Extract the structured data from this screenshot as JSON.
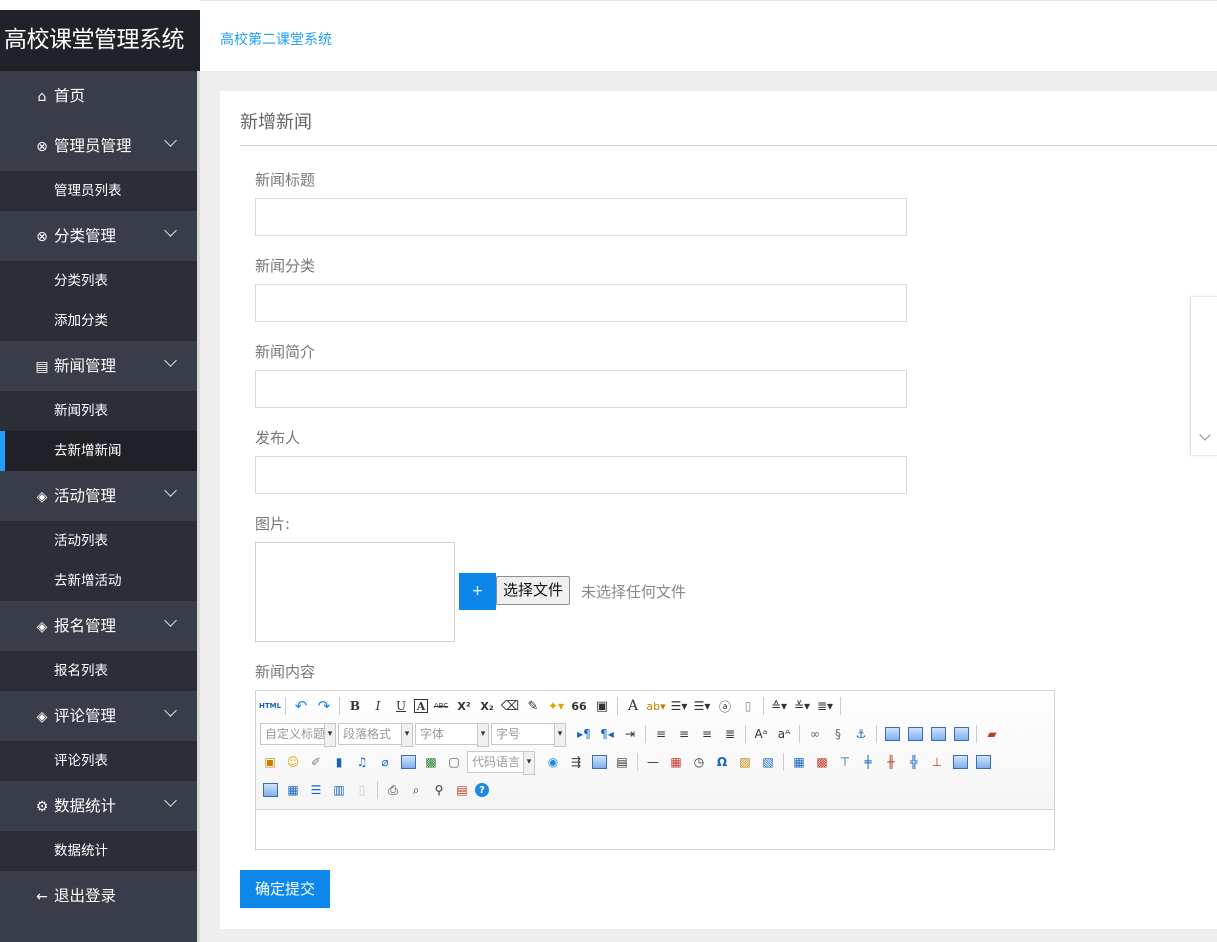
{
  "sidebar": {
    "logo": "高校课堂管理系统",
    "items": [
      {
        "icon": "home-icon",
        "glyph": "⌂",
        "label": "首页"
      },
      {
        "icon": "user-circle-icon",
        "glyph": "⊗",
        "label": "管理员管理",
        "sub": [
          "管理员列表"
        ]
      },
      {
        "icon": "user-circle-icon",
        "glyph": "⊗",
        "label": "分类管理",
        "sub": [
          "分类列表",
          "添加分类"
        ]
      },
      {
        "icon": "document-icon",
        "glyph": "▤",
        "label": "新闻管理",
        "sub": [
          "新闻列表",
          "去新增新闻"
        ]
      },
      {
        "icon": "layers-icon",
        "glyph": "◈",
        "label": "活动管理",
        "sub": [
          "活动列表",
          "去新增活动"
        ]
      },
      {
        "icon": "layers-icon",
        "glyph": "◈",
        "label": "报名管理",
        "sub": [
          "报名列表"
        ]
      },
      {
        "icon": "layers-icon",
        "glyph": "◈",
        "label": "评论管理",
        "sub": [
          "评论列表"
        ]
      },
      {
        "icon": "gear-icon",
        "glyph": "⚙",
        "label": "数据统计",
        "sub": [
          "数据统计"
        ]
      },
      {
        "icon": "arrow-left-icon",
        "glyph": "←",
        "label": "退出登录"
      }
    ],
    "active": "去新增新闻"
  },
  "header": {
    "breadcrumb": "高校第二课堂系统"
  },
  "form": {
    "title": "新增新闻",
    "title_label": "新闻标题",
    "title_value": "",
    "category_label": "新闻分类",
    "category_value": "",
    "summary_label": "新闻简介",
    "summary_value": "",
    "publisher_label": "发布人",
    "publisher_value": "",
    "image_label": "图片:",
    "plus": "+",
    "file_button": "选择文件",
    "file_status": "未选择任何文件",
    "content_label": "新闻内容",
    "submit": "确定提交"
  },
  "editor": {
    "selects": {
      "custom_title": "自定义标题",
      "paragraph": "段落格式",
      "font": "字体",
      "size": "字号",
      "code_lang": "代码语言"
    },
    "glyphs": {
      "html": "HTML",
      "undo": "↶",
      "redo": "↷",
      "bold": "B",
      "italic": "I",
      "underline": "U",
      "boxed_a": "A",
      "strike": "ABC",
      "sup": "X²",
      "sub": "X₂",
      "quote": "66",
      "font_color": "A",
      "omega": "Ω",
      "hr": "—",
      "help": "?"
    }
  },
  "colors": {
    "sidebar_bg": "#393D49",
    "logo_bg": "#20222A",
    "accent": "#1E9FFF",
    "button": "#0d88ea"
  }
}
